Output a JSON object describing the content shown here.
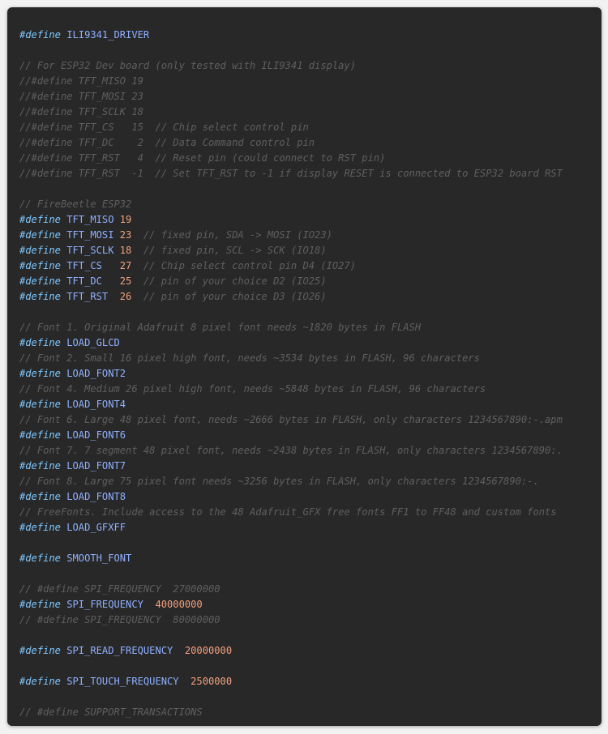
{
  "colors": {
    "background": "#282828",
    "keyword": "#7ec8ff",
    "identifier": "#8fb0ff",
    "number": "#f3a07e",
    "comment": "#5f5f5f"
  },
  "lines": [
    {
      "tokens": [
        {
          "t": "kw",
          "v": "#define"
        },
        {
          "t": "ws",
          "v": " "
        },
        {
          "t": "id",
          "v": "ILI9341_DRIVER"
        }
      ]
    },
    {
      "tokens": []
    },
    {
      "tokens": [
        {
          "t": "cm",
          "v": "// For ESP32 Dev board (only tested with ILI9341 display)"
        }
      ]
    },
    {
      "tokens": [
        {
          "t": "cm",
          "v": "//#define TFT_MISO 19"
        }
      ]
    },
    {
      "tokens": [
        {
          "t": "cm",
          "v": "//#define TFT_MOSI 23"
        }
      ]
    },
    {
      "tokens": [
        {
          "t": "cm",
          "v": "//#define TFT_SCLK 18"
        }
      ]
    },
    {
      "tokens": [
        {
          "t": "cm",
          "v": "//#define TFT_CS   15  // Chip select control pin"
        }
      ]
    },
    {
      "tokens": [
        {
          "t": "cm",
          "v": "//#define TFT_DC    2  // Data Command control pin"
        }
      ]
    },
    {
      "tokens": [
        {
          "t": "cm",
          "v": "//#define TFT_RST   4  // Reset pin (could connect to RST pin)"
        }
      ]
    },
    {
      "tokens": [
        {
          "t": "cm",
          "v": "//#define TFT_RST  -1  // Set TFT_RST to -1 if display RESET is connected to ESP32 board RST"
        }
      ]
    },
    {
      "tokens": []
    },
    {
      "tokens": [
        {
          "t": "cm",
          "v": "// FireBeetle ESP32"
        }
      ]
    },
    {
      "tokens": [
        {
          "t": "kw",
          "v": "#define"
        },
        {
          "t": "ws",
          "v": " "
        },
        {
          "t": "id",
          "v": "TFT_MISO"
        },
        {
          "t": "ws",
          "v": " "
        },
        {
          "t": "num",
          "v": "19"
        }
      ]
    },
    {
      "tokens": [
        {
          "t": "kw",
          "v": "#define"
        },
        {
          "t": "ws",
          "v": " "
        },
        {
          "t": "id",
          "v": "TFT_MOSI"
        },
        {
          "t": "ws",
          "v": " "
        },
        {
          "t": "num",
          "v": "23"
        },
        {
          "t": "ws",
          "v": "  "
        },
        {
          "t": "cm",
          "v": "// fixed pin, SDA -> MOSI (IO23)"
        }
      ]
    },
    {
      "tokens": [
        {
          "t": "kw",
          "v": "#define"
        },
        {
          "t": "ws",
          "v": " "
        },
        {
          "t": "id",
          "v": "TFT_SCLK"
        },
        {
          "t": "ws",
          "v": " "
        },
        {
          "t": "num",
          "v": "18"
        },
        {
          "t": "ws",
          "v": "  "
        },
        {
          "t": "cm",
          "v": "// fixed pin, SCL -> SCK (IO18)"
        }
      ]
    },
    {
      "tokens": [
        {
          "t": "kw",
          "v": "#define"
        },
        {
          "t": "ws",
          "v": " "
        },
        {
          "t": "id",
          "v": "TFT_CS"
        },
        {
          "t": "ws",
          "v": "   "
        },
        {
          "t": "num",
          "v": "27"
        },
        {
          "t": "ws",
          "v": "  "
        },
        {
          "t": "cm",
          "v": "// Chip select control pin D4 (IO27)"
        }
      ]
    },
    {
      "tokens": [
        {
          "t": "kw",
          "v": "#define"
        },
        {
          "t": "ws",
          "v": " "
        },
        {
          "t": "id",
          "v": "TFT_DC"
        },
        {
          "t": "ws",
          "v": "   "
        },
        {
          "t": "num",
          "v": "25"
        },
        {
          "t": "ws",
          "v": "  "
        },
        {
          "t": "cm",
          "v": "// pin of your choice D2 (IO25)"
        }
      ]
    },
    {
      "tokens": [
        {
          "t": "kw",
          "v": "#define"
        },
        {
          "t": "ws",
          "v": " "
        },
        {
          "t": "id",
          "v": "TFT_RST"
        },
        {
          "t": "ws",
          "v": "  "
        },
        {
          "t": "num",
          "v": "26"
        },
        {
          "t": "ws",
          "v": "  "
        },
        {
          "t": "cm",
          "v": "// pin of your choice D3 (IO26)"
        }
      ]
    },
    {
      "tokens": []
    },
    {
      "tokens": [
        {
          "t": "cm",
          "v": "// Font 1. Original Adafruit 8 pixel font needs ~1820 bytes in FLASH"
        }
      ]
    },
    {
      "tokens": [
        {
          "t": "kw",
          "v": "#define"
        },
        {
          "t": "ws",
          "v": " "
        },
        {
          "t": "id",
          "v": "LOAD_GLCD"
        }
      ]
    },
    {
      "tokens": [
        {
          "t": "cm",
          "v": "// Font 2. Small 16 pixel high font, needs ~3534 bytes in FLASH, 96 characters"
        }
      ]
    },
    {
      "tokens": [
        {
          "t": "kw",
          "v": "#define"
        },
        {
          "t": "ws",
          "v": " "
        },
        {
          "t": "id",
          "v": "LOAD_FONT2"
        }
      ]
    },
    {
      "tokens": [
        {
          "t": "cm",
          "v": "// Font 4. Medium 26 pixel high font, needs ~5848 bytes in FLASH, 96 characters"
        }
      ]
    },
    {
      "tokens": [
        {
          "t": "kw",
          "v": "#define"
        },
        {
          "t": "ws",
          "v": " "
        },
        {
          "t": "id",
          "v": "LOAD_FONT4"
        }
      ]
    },
    {
      "tokens": [
        {
          "t": "cm",
          "v": "// Font 6. Large 48 pixel font, needs ~2666 bytes in FLASH, only characters 1234567890:-.apm"
        }
      ]
    },
    {
      "tokens": [
        {
          "t": "kw",
          "v": "#define"
        },
        {
          "t": "ws",
          "v": " "
        },
        {
          "t": "id",
          "v": "LOAD_FONT6"
        }
      ]
    },
    {
      "tokens": [
        {
          "t": "cm",
          "v": "// Font 7. 7 segment 48 pixel font, needs ~2438 bytes in FLASH, only characters 1234567890:."
        }
      ]
    },
    {
      "tokens": [
        {
          "t": "kw",
          "v": "#define"
        },
        {
          "t": "ws",
          "v": " "
        },
        {
          "t": "id",
          "v": "LOAD_FONT7"
        }
      ]
    },
    {
      "tokens": [
        {
          "t": "cm",
          "v": "// Font 8. Large 75 pixel font needs ~3256 bytes in FLASH, only characters 1234567890:-."
        }
      ]
    },
    {
      "tokens": [
        {
          "t": "kw",
          "v": "#define"
        },
        {
          "t": "ws",
          "v": " "
        },
        {
          "t": "id",
          "v": "LOAD_FONT8"
        }
      ]
    },
    {
      "tokens": [
        {
          "t": "cm",
          "v": "// FreeFonts. Include access to the 48 Adafruit_GFX free fonts FF1 to FF48 and custom fonts"
        }
      ]
    },
    {
      "tokens": [
        {
          "t": "kw",
          "v": "#define"
        },
        {
          "t": "ws",
          "v": " "
        },
        {
          "t": "id",
          "v": "LOAD_GFXFF"
        }
      ]
    },
    {
      "tokens": []
    },
    {
      "tokens": [
        {
          "t": "kw",
          "v": "#define"
        },
        {
          "t": "ws",
          "v": " "
        },
        {
          "t": "id",
          "v": "SMOOTH_FONT"
        }
      ]
    },
    {
      "tokens": []
    },
    {
      "tokens": [
        {
          "t": "cm",
          "v": "// #define SPI_FREQUENCY  27000000"
        }
      ]
    },
    {
      "tokens": [
        {
          "t": "kw",
          "v": "#define"
        },
        {
          "t": "ws",
          "v": " "
        },
        {
          "t": "id",
          "v": "SPI_FREQUENCY"
        },
        {
          "t": "ws",
          "v": "  "
        },
        {
          "t": "num",
          "v": "40000000"
        }
      ]
    },
    {
      "tokens": [
        {
          "t": "cm",
          "v": "// #define SPI_FREQUENCY  80000000"
        }
      ]
    },
    {
      "tokens": []
    },
    {
      "tokens": [
        {
          "t": "kw",
          "v": "#define"
        },
        {
          "t": "ws",
          "v": " "
        },
        {
          "t": "id",
          "v": "SPI_READ_FREQUENCY"
        },
        {
          "t": "ws",
          "v": "  "
        },
        {
          "t": "num",
          "v": "20000000"
        }
      ]
    },
    {
      "tokens": []
    },
    {
      "tokens": [
        {
          "t": "kw",
          "v": "#define"
        },
        {
          "t": "ws",
          "v": " "
        },
        {
          "t": "id",
          "v": "SPI_TOUCH_FREQUENCY"
        },
        {
          "t": "ws",
          "v": "  "
        },
        {
          "t": "num",
          "v": "2500000"
        }
      ]
    },
    {
      "tokens": []
    },
    {
      "tokens": [
        {
          "t": "cm",
          "v": "// #define SUPPORT_TRANSACTIONS"
        }
      ]
    }
  ]
}
